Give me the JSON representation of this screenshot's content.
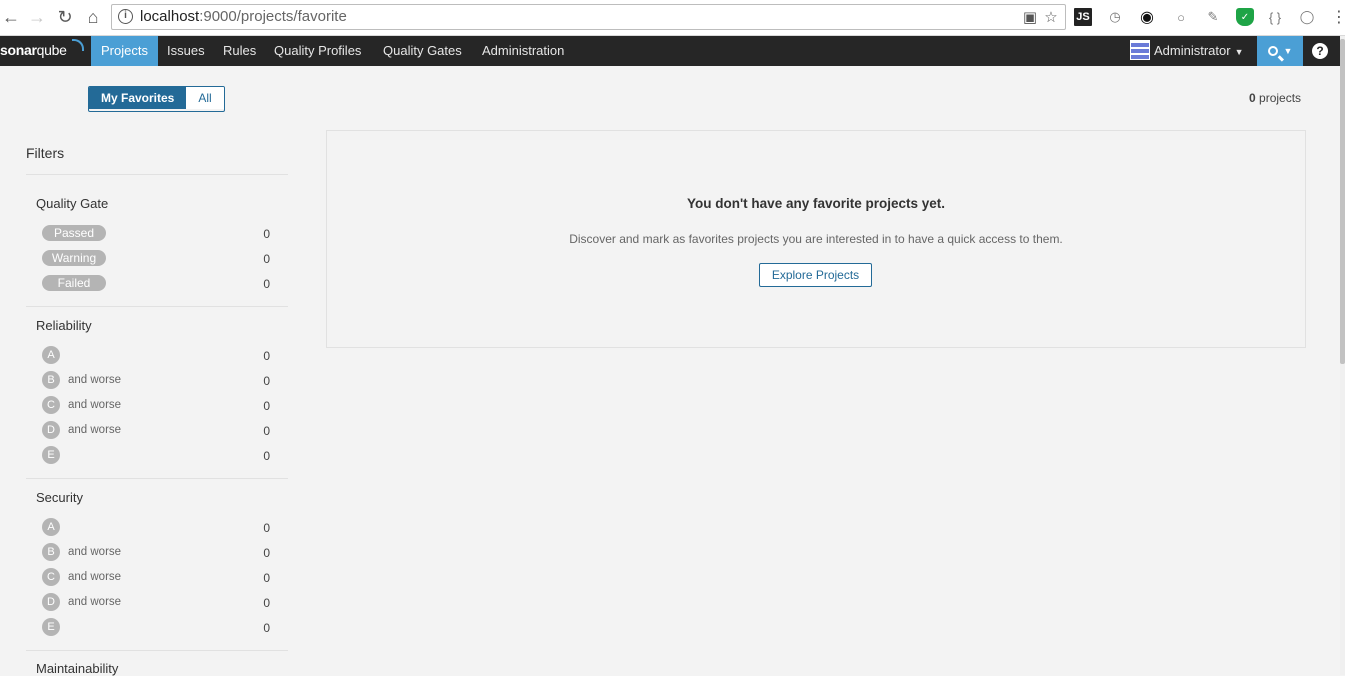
{
  "browser": {
    "url_host": "localhost",
    "url_path": ":9000/projects/favorite",
    "extensions": [
      "translate-icon",
      "bookmark-star-icon",
      "js-extension-icon",
      "clock-extension-icon",
      "eye-extension-icon",
      "circle-extension-icon",
      "tool-extension-icon",
      "green-shield-extension-icon",
      "braces-extension-icon",
      "grey-shield-extension-icon",
      "menu-icon"
    ],
    "js_label": "JS",
    "braces_label": "{ }"
  },
  "navbar": {
    "logo_bold": "sonar",
    "logo_rest": "qube",
    "items": [
      {
        "label": "Projects",
        "active": true
      },
      {
        "label": "Issues",
        "active": false
      },
      {
        "label": "Rules",
        "active": false
      },
      {
        "label": "Quality Profiles",
        "active": false
      },
      {
        "label": "Quality Gates",
        "active": false
      },
      {
        "label": "Administration",
        "active": false
      }
    ],
    "user": "Administrator",
    "help": "?"
  },
  "toggle": {
    "favorites": "My Favorites",
    "all": "All",
    "selected": "My Favorites"
  },
  "count": {
    "number": "0",
    "label": "projects"
  },
  "filters": {
    "title": "Filters",
    "quality_gate": {
      "title": "Quality Gate",
      "items": [
        {
          "label": "Passed",
          "count": "0"
        },
        {
          "label": "Warning",
          "count": "0"
        },
        {
          "label": "Failed",
          "count": "0"
        }
      ]
    },
    "and_worse": "and worse",
    "reliability": {
      "title": "Reliability",
      "items": [
        {
          "rating": "A",
          "suffix": false,
          "count": "0"
        },
        {
          "rating": "B",
          "suffix": true,
          "count": "0"
        },
        {
          "rating": "C",
          "suffix": true,
          "count": "0"
        },
        {
          "rating": "D",
          "suffix": true,
          "count": "0"
        },
        {
          "rating": "E",
          "suffix": false,
          "count": "0"
        }
      ]
    },
    "security": {
      "title": "Security",
      "items": [
        {
          "rating": "A",
          "suffix": false,
          "count": "0"
        },
        {
          "rating": "B",
          "suffix": true,
          "count": "0"
        },
        {
          "rating": "C",
          "suffix": true,
          "count": "0"
        },
        {
          "rating": "D",
          "suffix": true,
          "count": "0"
        },
        {
          "rating": "E",
          "suffix": false,
          "count": "0"
        }
      ]
    },
    "maintainability": {
      "title": "Maintainability"
    }
  },
  "empty": {
    "heading": "You don't have any favorite projects yet.",
    "message": "Discover and mark as favorites projects you are interested in to have a quick access to them.",
    "button": "Explore Projects"
  }
}
